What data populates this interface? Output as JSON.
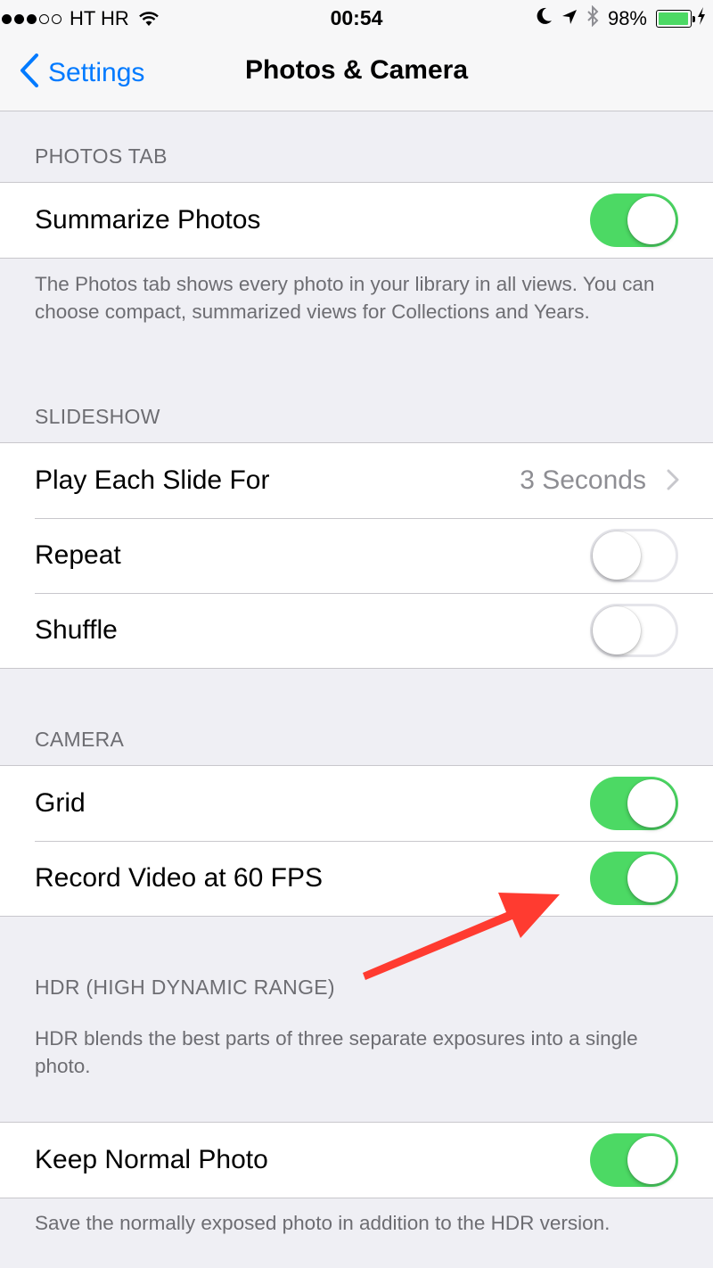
{
  "status_bar": {
    "carrier": "HT HR",
    "time": "00:54",
    "battery_percent": "98%",
    "signal_bars_filled": 3,
    "signal_bars_total": 5,
    "battery_level": 0.98,
    "icons": [
      "wifi-icon",
      "moon-icon",
      "location-arrow-icon",
      "bluetooth-icon",
      "battery-icon",
      "charging-bolt-icon"
    ]
  },
  "nav": {
    "back_label": "Settings",
    "title": "Photos & Camera"
  },
  "sections": {
    "photos_tab": {
      "header": "PHOTOS TAB",
      "summarize_label": "Summarize Photos",
      "summarize_on": true,
      "footer": "The Photos tab shows every photo in your library in all views. You can choose compact, summarized views for Collections and Years."
    },
    "slideshow": {
      "header": "SLIDESHOW",
      "play_each_label": "Play Each Slide For",
      "play_each_value": "3 Seconds",
      "repeat_label": "Repeat",
      "repeat_on": false,
      "shuffle_label": "Shuffle",
      "shuffle_on": false
    },
    "camera": {
      "header": "CAMERA",
      "grid_label": "Grid",
      "grid_on": true,
      "record_60fps_label": "Record Video at 60 FPS",
      "record_60fps_on": true
    },
    "hdr": {
      "header": "HDR (HIGH DYNAMIC RANGE)",
      "description": "HDR blends the best parts of three separate exposures into a single photo.",
      "keep_normal_label": "Keep Normal Photo",
      "keep_normal_on": true,
      "footer": "Save the normally exposed photo in addition to the HDR version."
    }
  },
  "colors": {
    "accent": "#007aff",
    "toggle_on": "#4cd964",
    "annotation_arrow": "#ff3b30",
    "background": "#efeff4"
  }
}
